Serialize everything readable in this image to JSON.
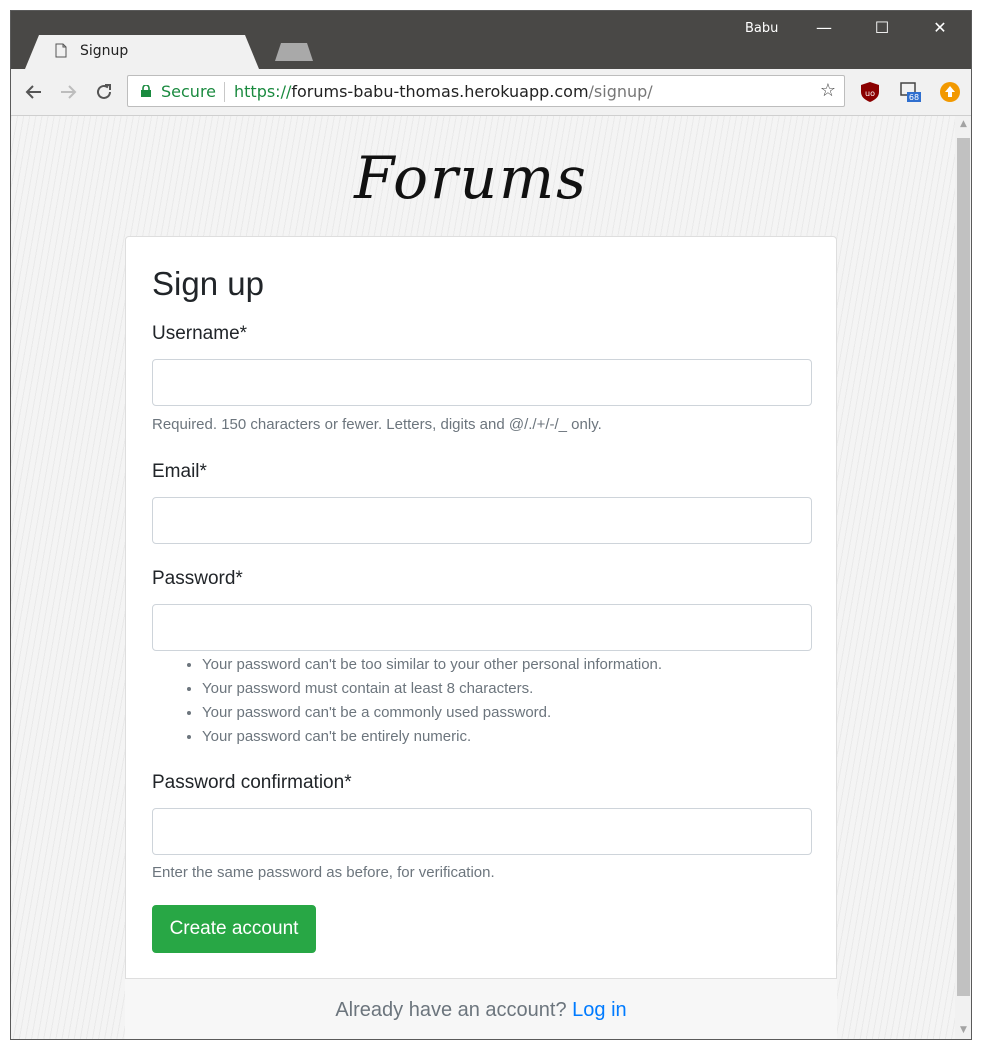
{
  "browser": {
    "tab_title": "Signup",
    "tab_close": "×",
    "user": "Babu",
    "minimize": "—",
    "maximize": "☐",
    "close": "✕",
    "secure_label": "Secure",
    "url_protocol": "https://",
    "url_host": "forums-babu-thomas.herokuapp.com",
    "url_path": "/signup/",
    "bookmark_star": "☆",
    "extensions": [
      {
        "name": "ublock-origin-icon",
        "badge": "uo",
        "color": "#8b0000"
      },
      {
        "name": "extension-icon",
        "badge": "68",
        "color": "#2f6fcf"
      },
      {
        "name": "update-icon",
        "color": "#f29900"
      }
    ]
  },
  "logo": {
    "text": "Forums"
  },
  "signup": {
    "title": "Sign up",
    "username_label": "Username*",
    "username_help": "Required. 150 characters or fewer. Letters, digits and @/./+/-/_ only.",
    "email_label": "Email*",
    "password_label": "Password*",
    "password_rules": [
      "Your password can't be too similar to your other personal information.",
      "Your password must contain at least 8 characters.",
      "Your password can't be a commonly used password.",
      "Your password can't be entirely numeric."
    ],
    "confirmation_label": "Password confirmation*",
    "confirmation_help": "Enter the same password as before, for verification.",
    "submit_label": "Create account",
    "footer_text": "Already have an account?",
    "footer_link": "Log in"
  },
  "colors": {
    "primary_button": "#28a745",
    "link": "#007bff",
    "secure": "#1a8a3f"
  }
}
